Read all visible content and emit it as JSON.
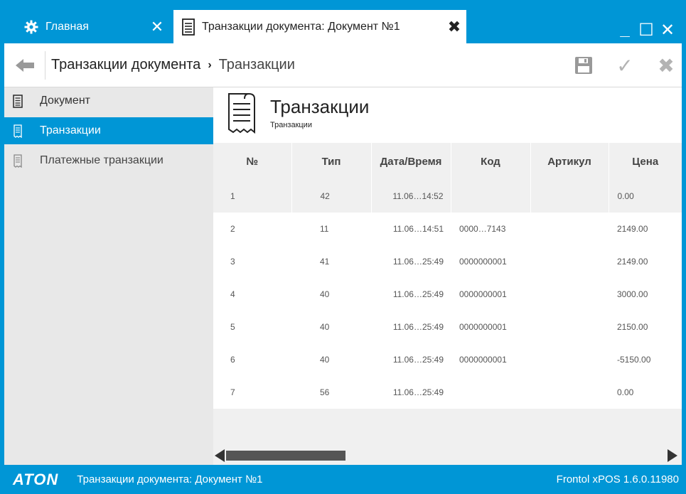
{
  "colors": {
    "accent": "#0096d6",
    "sidebar_bg": "#e8e8e8",
    "grid_bg": "#f0f0f0"
  },
  "tabs": [
    {
      "label": "Главная",
      "icon": "gear-icon",
      "active": false
    },
    {
      "label": "Транзакции документа: Документ №1",
      "icon": "document-icon",
      "active": true
    }
  ],
  "window_controls": {
    "minimize": "_",
    "maximize": "☐",
    "close": "✕"
  },
  "breadcrumb": {
    "parent": "Транзакции документа",
    "separator": "›",
    "current": "Транзакции"
  },
  "toolbar_icons": [
    "save-icon",
    "check-icon",
    "close-icon"
  ],
  "sidebar": {
    "items": [
      {
        "label": "Документ",
        "icon": "document-icon",
        "active": false
      },
      {
        "label": "Транзакции",
        "icon": "receipt-icon",
        "active": true
      },
      {
        "label": "Платежные транзакции",
        "icon": "receipt-icon",
        "active": false
      }
    ]
  },
  "page": {
    "title": "Транзакции",
    "subtitle": "Транзакции"
  },
  "table": {
    "columns": [
      "№",
      "Тип",
      "Дата/Время",
      "Код",
      "Артикул",
      "Цена"
    ],
    "rows": [
      {
        "n": "1",
        "type": "42",
        "datetime": "11.06…14:52",
        "code": "",
        "article": "",
        "price": "0.00"
      },
      {
        "n": "2",
        "type": "11",
        "datetime": "11.06…14:51",
        "code": "0000…7143",
        "article": "",
        "price": "2149.00"
      },
      {
        "n": "3",
        "type": "41",
        "datetime": "11.06…25:49",
        "code": "0000000001",
        "article": "",
        "price": "2149.00"
      },
      {
        "n": "4",
        "type": "40",
        "datetime": "11.06…25:49",
        "code": "0000000001",
        "article": "",
        "price": "3000.00"
      },
      {
        "n": "5",
        "type": "40",
        "datetime": "11.06…25:49",
        "code": "0000000001",
        "article": "",
        "price": "2150.00"
      },
      {
        "n": "6",
        "type": "40",
        "datetime": "11.06…25:49",
        "code": "0000000001",
        "article": "",
        "price": "-5150.00"
      },
      {
        "n": "7",
        "type": "56",
        "datetime": "11.06…25:49",
        "code": "",
        "article": "",
        "price": "0.00"
      }
    ]
  },
  "status": {
    "logo": "ATON",
    "text": "Транзакции документа: Документ №1",
    "version": "Frontol xPOS 1.6.0.11980"
  }
}
